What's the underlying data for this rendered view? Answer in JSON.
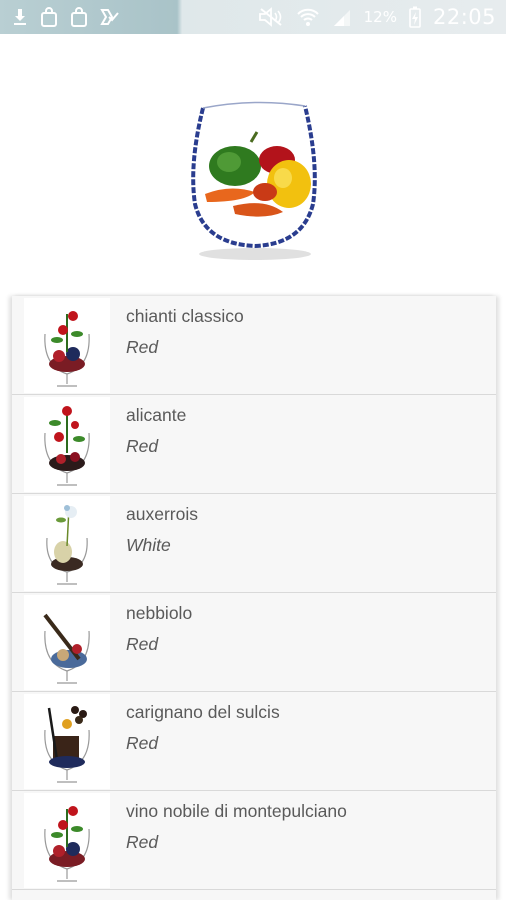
{
  "status_bar": {
    "battery_percent": "12%",
    "time": "22:05",
    "icons": [
      "download-icon",
      "shopping-bag-icon",
      "shopping-bag-icon",
      "check-icon",
      "mute-icon",
      "wifi-icon",
      "signal-icon",
      "battery-charging-icon"
    ]
  },
  "header": {
    "image": "peppers-in-wine-glass"
  },
  "wines": [
    {
      "name": "chianti classico",
      "type": "Red",
      "thumb": "roses-berries-glass"
    },
    {
      "name": "alicante",
      "type": "Red",
      "thumb": "roses-berries-glass"
    },
    {
      "name": "auxerrois",
      "type": "White",
      "thumb": "flower-pear-glass"
    },
    {
      "name": "nebbiolo",
      "type": "Red",
      "thumb": "tar-roses-glass"
    },
    {
      "name": "carignano del sulcis",
      "type": "Red",
      "thumb": "spice-fruit-glass"
    },
    {
      "name": "vino nobile di montepulciano",
      "type": "Red",
      "thumb": "roses-berries-glass"
    }
  ],
  "colors": {
    "list_background": "#f7f7f7",
    "divider": "#d9d9d9",
    "text": "#5a5a5a"
  }
}
